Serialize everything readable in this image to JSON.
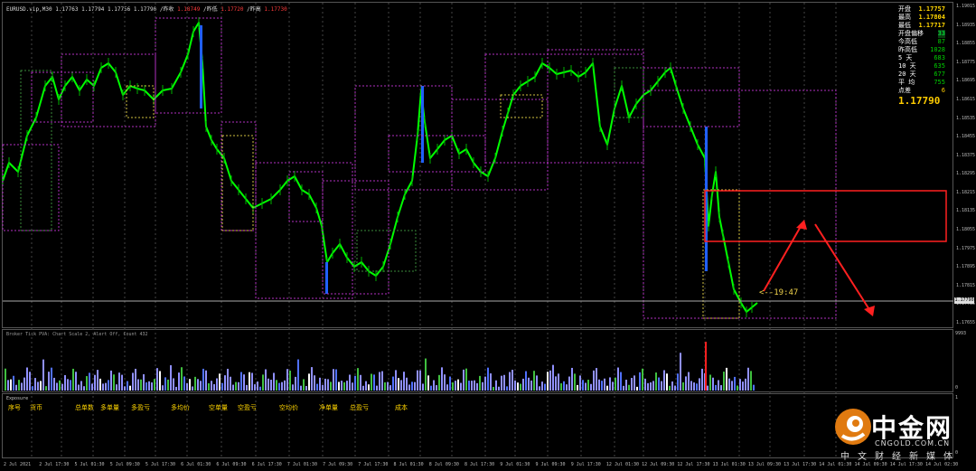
{
  "chart_header": {
    "symbol": "EURUSD.vip,M30",
    "ohlc": "1.17763 1.17794 1.17756 1.17790",
    "prev_close_label": "/昨收",
    "prev_close_value": "1.18749",
    "prev_low_label": "/昨低",
    "prev_low_value": "1.17720",
    "prev_high_label": "/昨高",
    "prev_high_value": "1.17730"
  },
  "info_panel": {
    "rows": [
      {
        "label": "开盘",
        "value": "1.17757",
        "style": "v-yellow"
      },
      {
        "label": "最高",
        "value": "1.17804",
        "style": "v-yellow"
      },
      {
        "label": "最低",
        "value": "1.17717",
        "style": "v-yellow"
      },
      {
        "label": "开盘偏移",
        "value": "33",
        "style": "hl"
      },
      {
        "label": "今高低",
        "value": "87",
        "style": "v-green"
      },
      {
        "label": "昨高低",
        "value": "1028",
        "style": "v-green"
      },
      {
        "label": "5  天",
        "value": "683",
        "style": "v-green"
      },
      {
        "label": "10 天",
        "value": "635",
        "style": "v-green"
      },
      {
        "label": "20 天",
        "value": "677",
        "style": "v-green"
      },
      {
        "label": "平  均",
        "value": "755",
        "style": "v-green"
      },
      {
        "label": "点差",
        "value": "6",
        "style": "v-yellow2"
      }
    ],
    "current_price": "1.17790"
  },
  "price_axis": {
    "ticks": [
      "1.19015",
      "1.18935",
      "1.18855",
      "1.18775",
      "1.18695",
      "1.18615",
      "1.18535",
      "1.18455",
      "1.18375",
      "1.18295",
      "1.18215",
      "1.18135",
      "1.18055",
      "1.17975",
      "1.17895",
      "1.17815",
      "1.17735",
      "1.17655"
    ],
    "current_price_tag": "1.17790"
  },
  "volume_panel": {
    "title": "Broker Tick PVA: Chart Scale 2, Alert Off, Count 432",
    "axis_top": "9993",
    "axis_bottom": "0"
  },
  "exposure_panel": {
    "title": "Exposure",
    "labels": [
      "序号",
      "货币",
      "总单数",
      "多单量",
      "多盈亏",
      "多均价",
      "空单量",
      "空盈亏",
      "空均价",
      "净单量",
      "总盈亏",
      "成本"
    ],
    "axis_top": "1",
    "axis_bottom": "0"
  },
  "time_axis": {
    "labels": [
      "2 Jul 2021",
      "2 Jul 17:30",
      "5 Jul 01:30",
      "5 Jul 09:30",
      "5 Jul 17:30",
      "6 Jul 01:30",
      "6 Jul 09:30",
      "6 Jul 17:30",
      "7 Jul 01:30",
      "7 Jul 09:30",
      "7 Jul 17:30",
      "8 Jul 01:30",
      "8 Jul 09:30",
      "8 Jul 17:30",
      "9 Jul 01:30",
      "9 Jul 09:30",
      "9 Jul 17:30",
      "12 Jul 01:30",
      "12 Jul 09:30",
      "12 Jul 17:30",
      "13 Jul 01:30",
      "13 Jul 09:30",
      "13 Jul 17:30",
      "14 Jul 01:30",
      "14 Jul 09:30",
      "14 Jul 17:30",
      "14 Jul 02:30"
    ]
  },
  "annotation": {
    "time_marker": "<--19:47"
  },
  "watermark": {
    "brand_cn": "中金网",
    "brand_en": "CNGOLD.COM.CN",
    "slogan": "中文财经新媒体"
  },
  "colors": {
    "candle_up": "#00ff00",
    "candle_down": "#00b000",
    "highlight_bar": "#2060ff",
    "box_magenta": "#b030c0",
    "box_yellow": "#d0c040",
    "box_green": "#3a8a3a",
    "arrow_red": "#ff2020"
  }
}
